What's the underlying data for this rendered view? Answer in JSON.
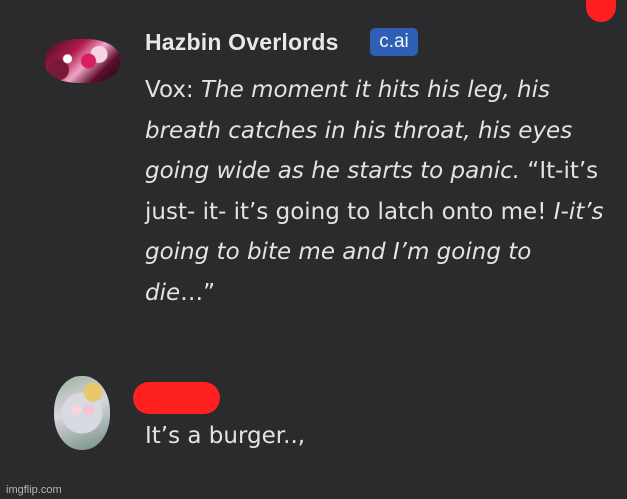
{
  "bot_message": {
    "author": "Hazbin Overlords",
    "badge": "c.ai",
    "segments": [
      {
        "text": "Vox: ",
        "italic": false
      },
      {
        "text": "The moment it hits his leg, his breath catches in his throat, his eyes going wide as he starts to panic.",
        "italic": true
      },
      {
        "text": " “It-it’s just- it- it’s going to latch onto me! ",
        "italic": false
      },
      {
        "text": "I-it’s going to bite me and I’m going to die",
        "italic": true
      },
      {
        "text": "…”",
        "italic": false
      }
    ]
  },
  "user_message": {
    "text": "It’s a burger..,"
  },
  "watermark": "imgflip.com",
  "colors": {
    "background": "#2b2b2d",
    "badge": "#2f5fb4",
    "redaction": "#ff2020",
    "text": "#e3e3e3"
  }
}
